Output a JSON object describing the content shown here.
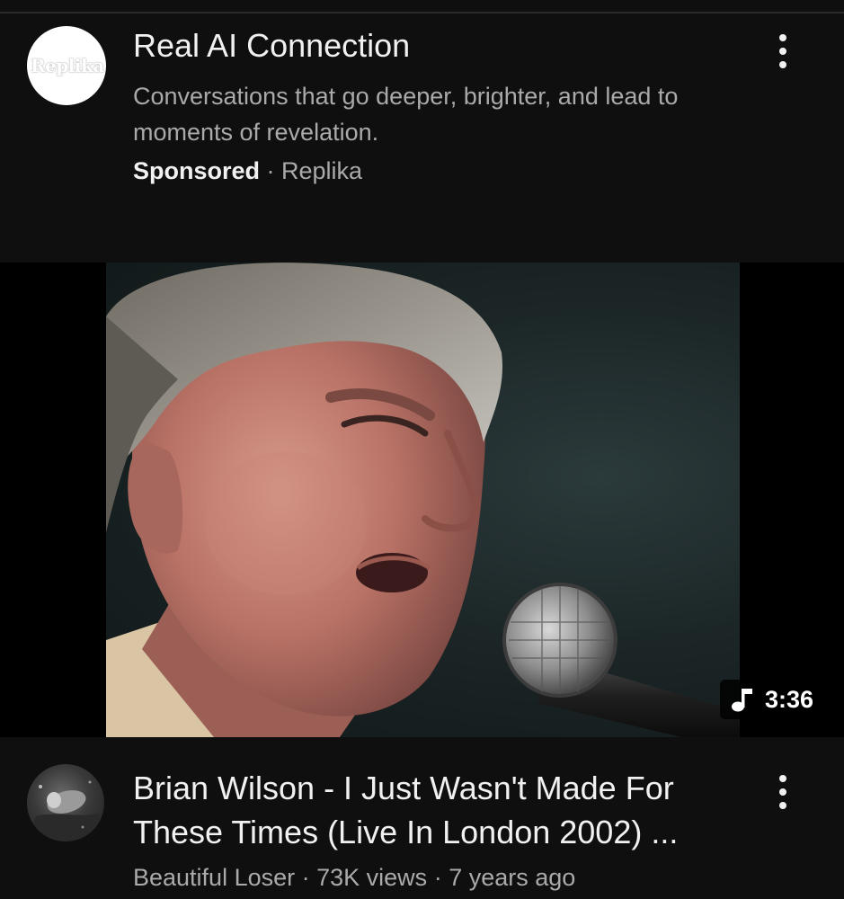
{
  "ad": {
    "logo_text": "Replika",
    "title": "Real AI Connection",
    "description": "Conversations that go deeper, brighter, and lead to moments of revelation.",
    "sponsored_label": "Sponsored",
    "separator": " · ",
    "advertiser": "Replika",
    "menu_icon": "more-vert-icon"
  },
  "video": {
    "duration": "3:36",
    "music_icon": "music-note-icon",
    "title": "Brian Wilson - I Just Wasn't Made For These Times (Live In London 2002) ...",
    "channel": "Beautiful Loser",
    "views": "73K views",
    "age": "7 years ago",
    "meta_separator": " · ",
    "menu_icon": "more-vert-icon"
  },
  "colors": {
    "background": "#0f0f0f",
    "primary_text": "#f1f1f1",
    "secondary_text": "#aaaaaa",
    "thumbnail_letterbox": "#000000"
  }
}
